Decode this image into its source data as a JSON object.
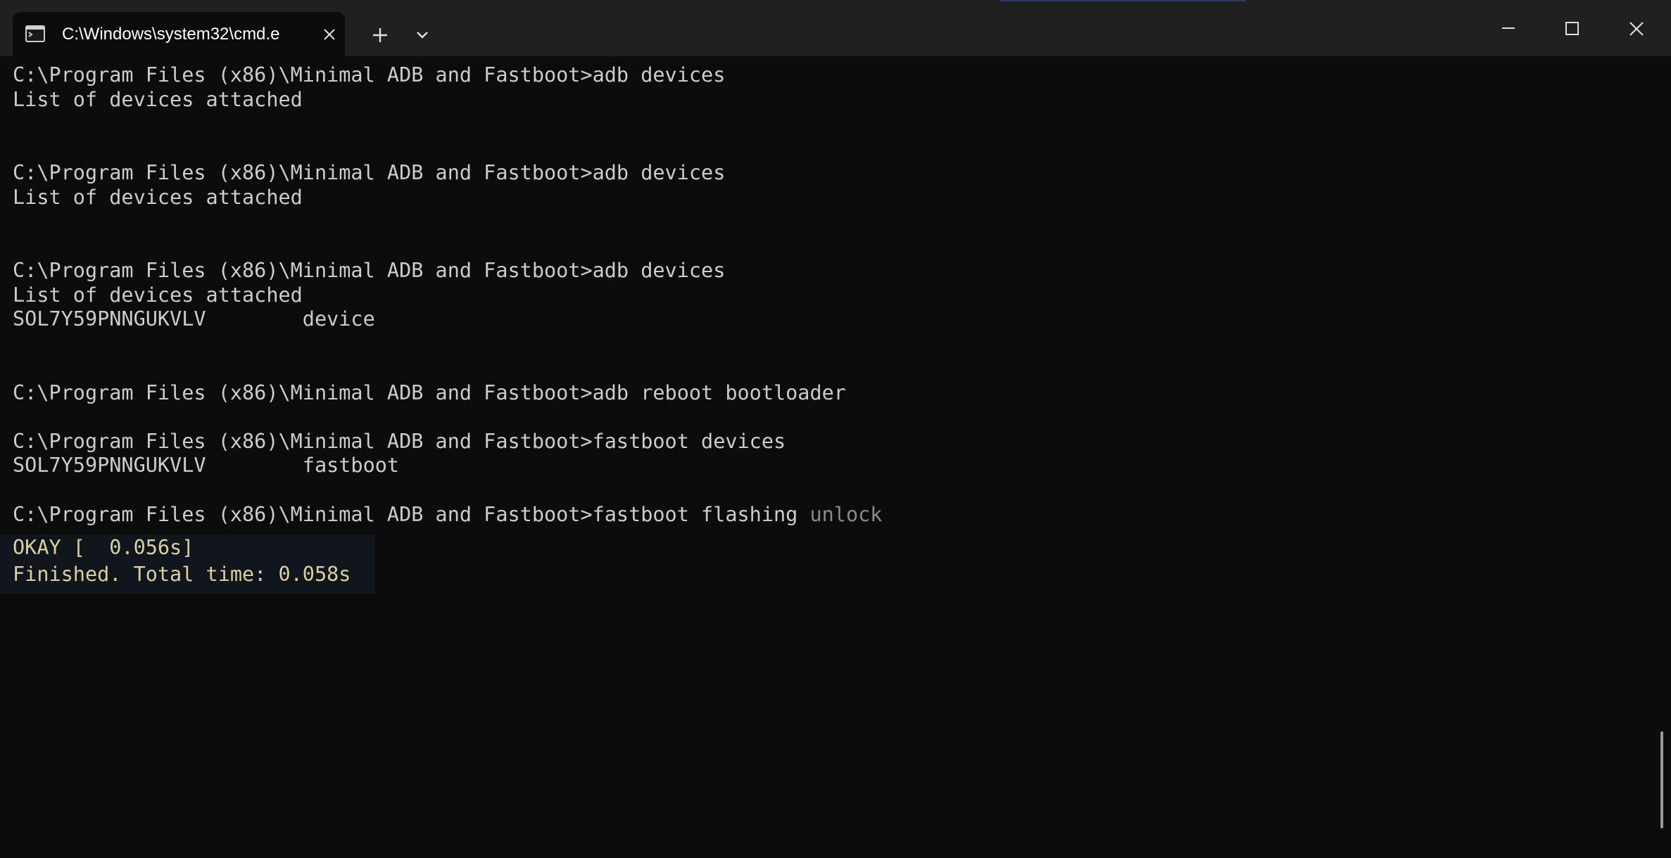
{
  "window": {
    "tab_title": "C:\\Windows\\system32\\cmd.e",
    "icons": {
      "tab": "cmd-icon",
      "close_tab": "close-icon",
      "new_tab": "plus-icon",
      "dropdown": "chevron-down-icon",
      "minimize": "minimize-icon",
      "maximize": "maximize-icon",
      "close_window": "close-icon"
    }
  },
  "terminal": {
    "lines": [
      "C:\\Program Files (x86)\\Minimal ADB and Fastboot>adb devices",
      "List of devices attached",
      "C:\\Program Files (x86)\\Minimal ADB and Fastboot>adb devices",
      "List of devices attached",
      "C:\\Program Files (x86)\\Minimal ADB and Fastboot>adb devices",
      "List of devices attached",
      "SOL7Y59PNNGUKVLV        device",
      "C:\\Program Files (x86)\\Minimal ADB and Fastboot>adb reboot bootloader",
      "C:\\Program Files (x86)\\Minimal ADB and Fastboot>fastboot devices",
      "SOL7Y59PNNGUKVLV        fastboot",
      "C:\\Program Files (x86)\\Minimal ADB and Fastboot>fastboot flashing ",
      "OKAY [  0.056s]",
      "Finished. Total time: 0.058s"
    ],
    "last_command_word": "unlock"
  },
  "colors": {
    "background": "#0c0c0c",
    "titlebar": "#202020",
    "text": "#cccccc",
    "okay_text": "#d8d0a0"
  }
}
